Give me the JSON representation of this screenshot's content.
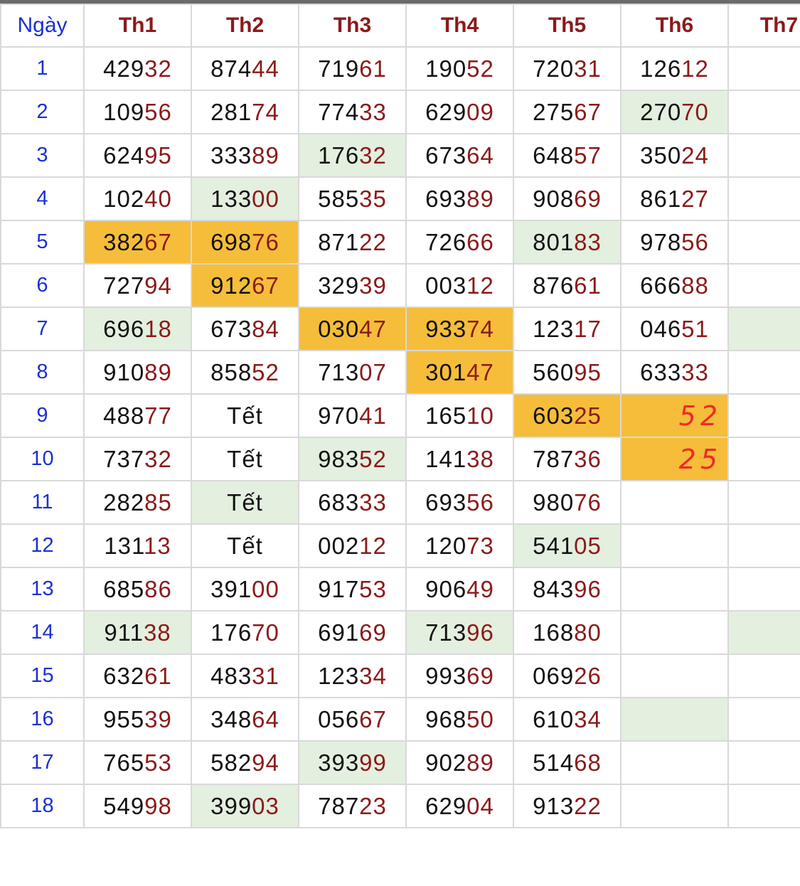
{
  "header": {
    "day_label": "Ngày",
    "columns": [
      "Th1",
      "Th2",
      "Th3",
      "Th4",
      "Th5",
      "Th6",
      "Th7"
    ]
  },
  "colors": {
    "header_text": "#8b1a1a",
    "day_text": "#1a2fd6",
    "highlight_green": "#e3efdf",
    "highlight_orange": "#f5bd3a",
    "annotation_red": "#ee2a2a"
  },
  "rows": [
    {
      "day": "1",
      "cells": [
        "42932",
        "87444",
        "71961",
        "19052",
        "72031",
        "12612",
        ""
      ],
      "hl": [
        "",
        "",
        "",
        "",
        "",
        "",
        ""
      ]
    },
    {
      "day": "2",
      "cells": [
        "10956",
        "28174",
        "77433",
        "62909",
        "27567",
        "27070",
        ""
      ],
      "hl": [
        "",
        "",
        "",
        "",
        "",
        "g",
        ""
      ]
    },
    {
      "day": "3",
      "cells": [
        "62495",
        "33389",
        "17632",
        "67364",
        "64857",
        "35024",
        ""
      ],
      "hl": [
        "",
        "",
        "g",
        "",
        "",
        "",
        ""
      ]
    },
    {
      "day": "4",
      "cells": [
        "10240",
        "13300",
        "58535",
        "69389",
        "90869",
        "86127",
        ""
      ],
      "hl": [
        "",
        "g",
        "",
        "",
        "",
        "",
        ""
      ]
    },
    {
      "day": "5",
      "cells": [
        "38267",
        "69876",
        "87122",
        "72666",
        "80183",
        "97856",
        ""
      ],
      "hl": [
        "o",
        "o",
        "",
        "",
        "g",
        "",
        ""
      ]
    },
    {
      "day": "6",
      "cells": [
        "72794",
        "91267",
        "32939",
        "00312",
        "87661",
        "66688",
        ""
      ],
      "hl": [
        "",
        "o",
        "",
        "",
        "",
        "",
        ""
      ]
    },
    {
      "day": "7",
      "cells": [
        "69618",
        "67384",
        "03047",
        "93374",
        "12317",
        "04651",
        ""
      ],
      "hl": [
        "g",
        "",
        "o",
        "o",
        "",
        "",
        "g"
      ]
    },
    {
      "day": "8",
      "cells": [
        "91089",
        "85852",
        "71307",
        "30147",
        "56095",
        "63333",
        ""
      ],
      "hl": [
        "",
        "",
        "",
        "o",
        "",
        "",
        ""
      ]
    },
    {
      "day": "9",
      "cells": [
        "48877",
        "Tết",
        "97041",
        "16510",
        "60325",
        "52",
        ""
      ],
      "hl": [
        "",
        "",
        "",
        "",
        "o",
        "o",
        ""
      ]
    },
    {
      "day": "10",
      "cells": [
        "73732",
        "Tết",
        "98352",
        "14138",
        "78736",
        "25",
        ""
      ],
      "hl": [
        "",
        "",
        "g",
        "",
        "",
        "o",
        ""
      ]
    },
    {
      "day": "11",
      "cells": [
        "28285",
        "Tết",
        "68333",
        "69356",
        "98076",
        "",
        ""
      ],
      "hl": [
        "",
        "g",
        "",
        "",
        "",
        "",
        ""
      ]
    },
    {
      "day": "12",
      "cells": [
        "13113",
        "Tết",
        "00212",
        "12073",
        "54105",
        "",
        ""
      ],
      "hl": [
        "",
        "",
        "",
        "",
        "g",
        "",
        ""
      ]
    },
    {
      "day": "13",
      "cells": [
        "68586",
        "39100",
        "91753",
        "90649",
        "84396",
        "",
        ""
      ],
      "hl": [
        "",
        "",
        "",
        "",
        "",
        "",
        ""
      ]
    },
    {
      "day": "14",
      "cells": [
        "91138",
        "17670",
        "69169",
        "71396",
        "16880",
        "",
        ""
      ],
      "hl": [
        "g",
        "",
        "",
        "g",
        "",
        "",
        "g"
      ]
    },
    {
      "day": "15",
      "cells": [
        "63261",
        "48331",
        "12334",
        "99369",
        "06926",
        "",
        ""
      ],
      "hl": [
        "",
        "",
        "",
        "",
        "",
        "",
        ""
      ]
    },
    {
      "day": "16",
      "cells": [
        "95539",
        "34864",
        "05667",
        "96850",
        "61034",
        "",
        ""
      ],
      "hl": [
        "",
        "",
        "",
        "",
        "",
        "g",
        ""
      ]
    },
    {
      "day": "17",
      "cells": [
        "76553",
        "58294",
        "39399",
        "90289",
        "51468",
        "",
        ""
      ],
      "hl": [
        "",
        "",
        "g",
        "",
        "",
        "",
        ""
      ]
    },
    {
      "day": "18",
      "cells": [
        "54998",
        "39903",
        "78723",
        "62904",
        "91322",
        "",
        ""
      ],
      "hl": [
        "",
        "g",
        "",
        "",
        "",
        "",
        ""
      ]
    }
  ]
}
